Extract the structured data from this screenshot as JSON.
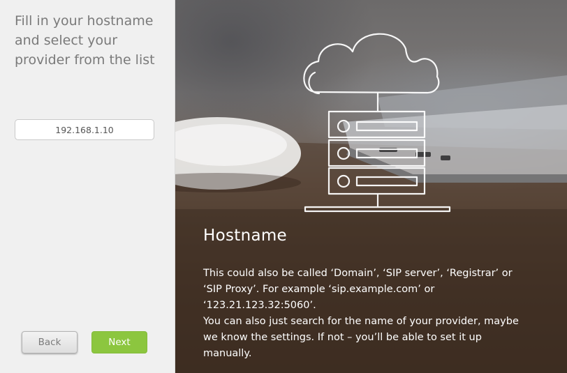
{
  "left_panel": {
    "instruction": " Fill in your hostname\nand select your\nprovider from the list",
    "hostname_value": "192.168.1.10",
    "back_label": "Back",
    "next_label": "Next"
  },
  "info_panel": {
    "title": "Hostname",
    "paragraph1": " This could also be called ‘Domain’, ‘SIP server’, ‘Registrar’ or ‘SIP Proxy’. For example ‘sip.example.com’ or ‘123.21.123.32:5060’.",
    "paragraph2": "You can also just search for the name of your provider, maybe we know the settings. If not – you’ll be able to set it up manually."
  },
  "illustration": {
    "icon": "cloud-server-network-icon"
  },
  "colors": {
    "accent_green": "#8cc63f",
    "panel_bg": "#f0f0f0",
    "instruction_text": "#7a7a7a"
  }
}
